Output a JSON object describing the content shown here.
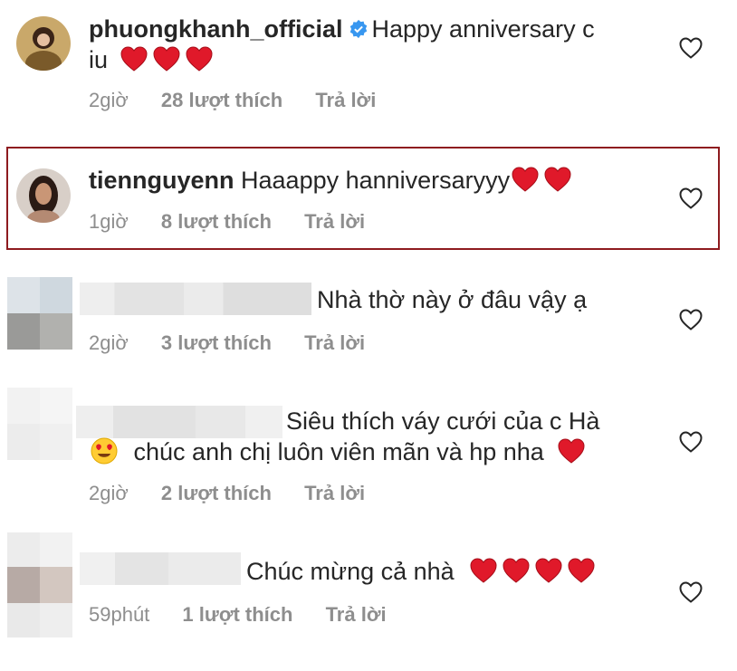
{
  "colors": {
    "heart": "#e0192a",
    "verified": "#3897f0",
    "meta_text": "#8e8e8e",
    "highlight_border": "#8e1b1f"
  },
  "comments": [
    {
      "username": "phuongkhanh_official",
      "verified": true,
      "text_line1": "Happy anniversary c",
      "text_line2": "iu",
      "hearts": 3,
      "time": "2giờ",
      "likes": "28 lượt thích",
      "reply": "Trả lời"
    },
    {
      "username": "tiennguyenn",
      "text": "Haaappy hanniversaryyy",
      "hearts": 2,
      "time": "1giờ",
      "likes": "8 lượt thích",
      "reply": "Trả lời"
    },
    {
      "text": "Nhà thờ này ở đâu vậy ạ",
      "time": "2giờ",
      "likes": "3 lượt thích",
      "reply": "Trả lời"
    },
    {
      "text_line1": "Siêu thích váy cưới của c Hà",
      "text_line2": "chúc anh chị luôn viên mãn và hp nha",
      "hearts": 1,
      "time": "2giờ",
      "likes": "2 lượt thích",
      "reply": "Trả lời"
    },
    {
      "text": "Chúc mừng cả nhà",
      "hearts": 4,
      "time": "59phút",
      "likes": "1 lượt thích",
      "reply": "Trả lời"
    }
  ],
  "icons": {
    "like": "heart-outline-icon",
    "verified": "verified-badge-icon",
    "heart_emoji": "red-heart-emoji",
    "heart_eyes": "heart-eyes-emoji"
  }
}
